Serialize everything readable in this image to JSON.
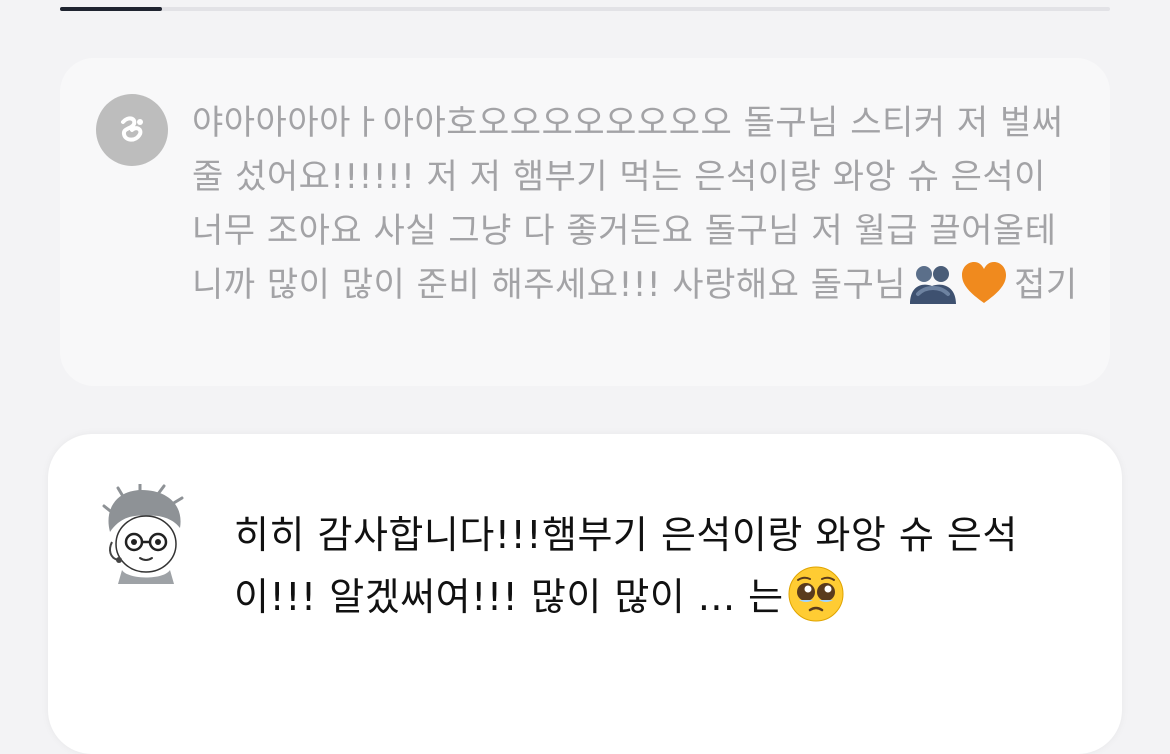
{
  "progress": {
    "value": 0.097,
    "track_color": "#e2e2e6",
    "fill_color": "#1f2430"
  },
  "fan_message": {
    "avatar_icon": "fan-avatar-icon",
    "text": "야아아아아ㅏ아아호오오오오오오오오 돌구님 스티커 저 벌써 줄 섰어요!!!!!! 저 저 햄부기 먹는 은석이랑 와앙 슈 은석이 너무 조아요 사실 그냥 다 좋거든요 돌구님 저 월급 끌어올테니까 많이 많이 준비 해주세요!!! 사랑해요 돌구님",
    "emoji_1": "people-hugging-emoji",
    "emoji_2": "orange-heart-emoji",
    "collapse_label": "접기",
    "text_color": "#a3a3a6"
  },
  "reply": {
    "avatar_icon": "artist-avatar-illustration",
    "text": "히히 감사합니다!!!햄부기 은석이랑 와앙 슈 은석이!!! 알겠써여!!! 많이 많이 ... 는",
    "emoji": "pleading-face-emoji",
    "text_color": "#111111"
  }
}
